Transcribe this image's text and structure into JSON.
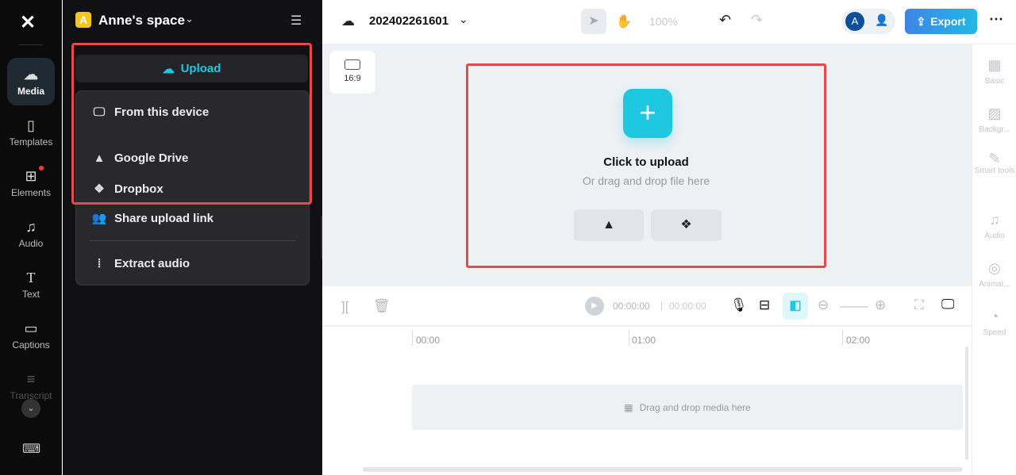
{
  "rail": {
    "items": [
      {
        "label": "Media",
        "icon": "cloud-upload-icon"
      },
      {
        "label": "Templates",
        "icon": "template-icon"
      },
      {
        "label": "Elements",
        "icon": "elements-icon"
      },
      {
        "label": "Audio",
        "icon": "music-icon"
      },
      {
        "label": "Text",
        "icon": "text-icon"
      },
      {
        "label": "Captions",
        "icon": "captions-icon"
      },
      {
        "label": "Transcript",
        "icon": "transcript-icon"
      }
    ]
  },
  "workspace": {
    "avatar_letter": "A",
    "name": "Anne's space"
  },
  "upload": {
    "button_label": "Upload",
    "menu": [
      "From this device",
      "Google Drive",
      "Dropbox",
      "Share upload link",
      "Extract audio"
    ]
  },
  "header": {
    "project_name": "202402261601",
    "zoom": "100%",
    "avatar_letter": "A",
    "export_label": "Export"
  },
  "canvas": {
    "ratio": "16:9",
    "title": "Click to upload",
    "subtitle": "Or drag and drop file here"
  },
  "right_panel": [
    "Basic",
    "Backgr...",
    "Smart tools",
    "Audio",
    "Animat...",
    "Speed"
  ],
  "timeline": {
    "current_time": "00:00:00",
    "total_time": "00:00:00",
    "ticks": [
      "00:00",
      "01:00",
      "02:00"
    ],
    "drop_hint": "Drag and drop media here"
  },
  "colors": {
    "accent": "#1ec8e0",
    "highlight": "#e84a4a",
    "export": "#2f8ee6"
  }
}
